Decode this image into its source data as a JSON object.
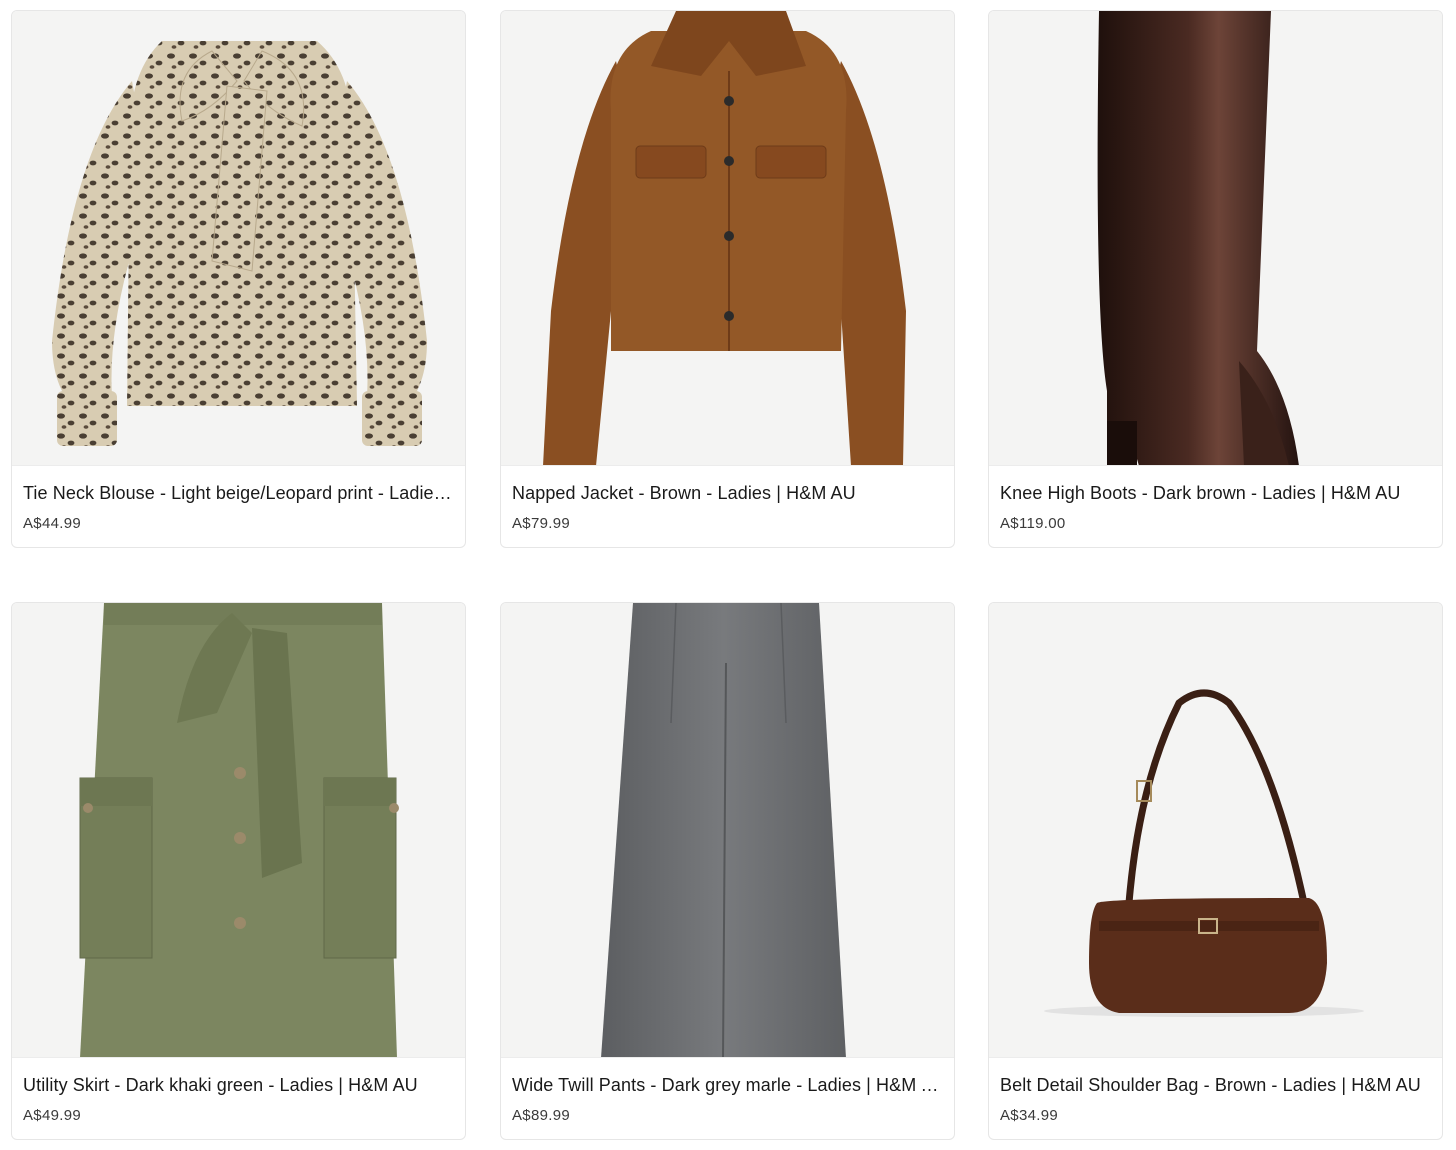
{
  "products": [
    {
      "title": "Tie Neck Blouse - Light beige/Leopard print - Ladies | H&M AU",
      "price": "A$44.99",
      "image": "leopard-blouse-image"
    },
    {
      "title": "Napped Jacket - Brown - Ladies | H&M AU",
      "price": "A$79.99",
      "image": "brown-jacket-image"
    },
    {
      "title": "Knee High Boots - Dark brown - Ladies | H&M AU",
      "price": "A$119.00",
      "image": "knee-high-boot-image"
    },
    {
      "title": "Utility Skirt - Dark khaki green - Ladies | H&M AU",
      "price": "A$49.99",
      "image": "khaki-skirt-image"
    },
    {
      "title": "Wide Twill Pants - Dark grey marle - Ladies | H&M AU",
      "price": "A$89.99",
      "image": "grey-pants-image"
    },
    {
      "title": "Belt Detail Shoulder Bag - Brown - Ladies | H&M AU",
      "price": "A$34.99",
      "image": "shoulder-bag-image"
    }
  ],
  "colors": {
    "leopard_base": "#d8ccb2",
    "leopard_spot": "#4a3f33",
    "jacket": "#8a4f22",
    "boot": "#2e1a15",
    "skirt": "#7c8660",
    "pants": "#6b6d70",
    "bag": "#5a2d1a"
  }
}
